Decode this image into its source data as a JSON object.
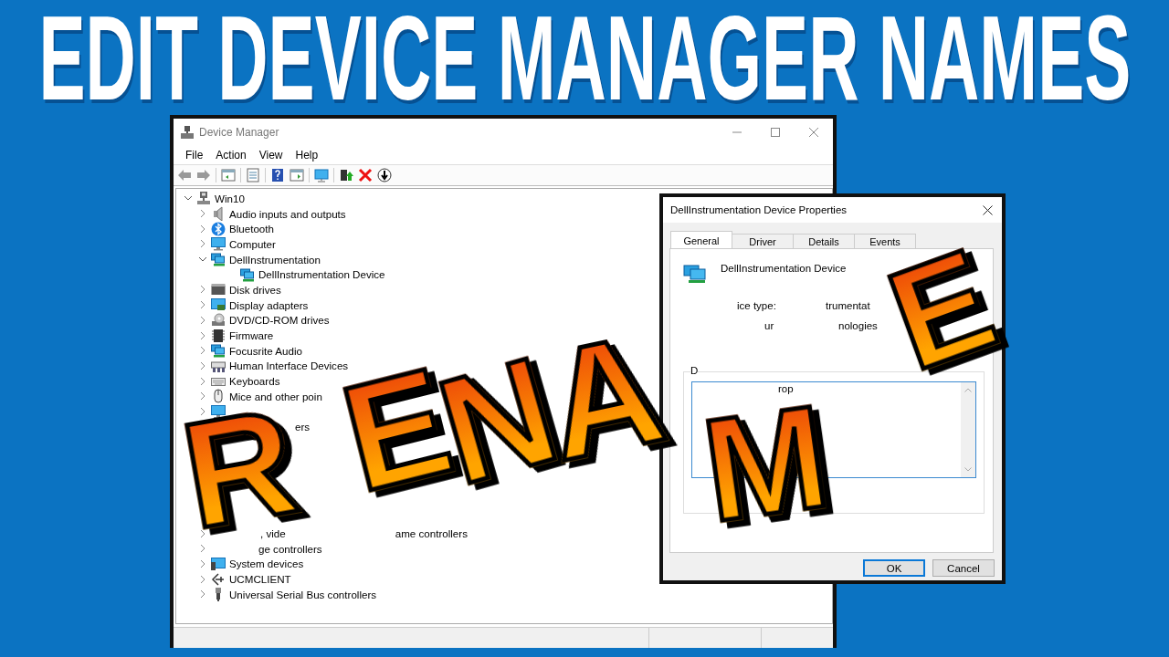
{
  "headline": "EDIT DEVICE MANAGER NAMES",
  "device_manager": {
    "title": "Device Manager",
    "menu": [
      "File",
      "Action",
      "View",
      "Help"
    ],
    "tree": {
      "label": "Win10",
      "expanded": true,
      "children": [
        {
          "label": "Audio inputs and outputs",
          "expanded": false
        },
        {
          "label": "Bluetooth",
          "expanded": false
        },
        {
          "label": "Computer",
          "expanded": false
        },
        {
          "label": "DellInstrumentation",
          "expanded": true,
          "children": [
            {
              "label": "DellInstrumentation Device"
            }
          ]
        },
        {
          "label": "Disk drives",
          "expanded": false
        },
        {
          "label": "Display adapters",
          "expanded": false
        },
        {
          "label": "DVD/CD-ROM drives",
          "expanded": false
        },
        {
          "label": "Firmware",
          "expanded": false
        },
        {
          "label": "Focusrite Audio",
          "expanded": false
        },
        {
          "label": "Human Interface Devices",
          "expanded": false
        },
        {
          "label": "Keyboards",
          "expanded": false
        },
        {
          "label": "Mice and other poin",
          "expanded": false
        },
        {
          "expanded": false
        },
        {
          "label": "ers"
        },
        {
          "label_parts": [
            ", vide",
            "ame controllers"
          ],
          "expanded": false
        },
        {
          "label": "ge controllers",
          "expanded": false
        },
        {
          "label": "System devices",
          "expanded": false
        },
        {
          "label": "UCMCLIENT",
          "expanded": false
        },
        {
          "label": "Universal Serial Bus controllers",
          "expanded": false
        }
      ]
    }
  },
  "properties_dialog": {
    "title": "DellInstrumentation Device Properties",
    "tabs": [
      {
        "label": "General",
        "selected": true
      },
      {
        "label": "Driver",
        "selected": false
      },
      {
        "label": "Details",
        "selected": false
      },
      {
        "label": "Events",
        "selected": false
      }
    ],
    "device_name": "DellInstrumentation Device",
    "device_type_label": "ice type:",
    "device_type_value": "trumentat",
    "manufacturer_label": "ur",
    "manufacturer_value": "nologies",
    "group_label": "D",
    "status_text": "rop",
    "buttons": [
      {
        "label": "OK",
        "default": true
      },
      {
        "label": "Cancel",
        "default": false
      }
    ]
  },
  "overlay_letters": [
    "R",
    "E",
    "N",
    "A",
    "M",
    "E"
  ]
}
